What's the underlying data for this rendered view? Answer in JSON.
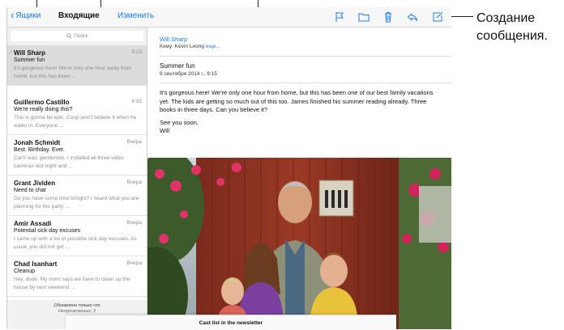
{
  "navbar": {
    "back_label": "Ящики",
    "title": "Входящие",
    "edit_label": "Изменить"
  },
  "toolbar_icons": [
    "flag-icon",
    "folder-icon",
    "trash-icon",
    "reply-icon",
    "compose-icon"
  ],
  "search": {
    "placeholder": "Поиск"
  },
  "mail_list": [
    {
      "sender": "Will Sharp",
      "time": "9:15",
      "subject": "Summer fun",
      "preview": "It's gorgeous here! We're only one hour away from home, but this has been ...",
      "selected": true
    },
    {
      "sender": "Guillermo Castillo",
      "time": "8:32",
      "subject": "We're really doing this?",
      "preview": "This is gonna be epic. Coop won't believe it when he walks in. Everyone ...",
      "selected": false
    },
    {
      "sender": "Jonah Schmidt",
      "time": "Вчера",
      "subject": "Best. Birthday. Ever.",
      "preview": "Can't wait, gentlemen. I installed all three video cameras last night and ...",
      "selected": false
    },
    {
      "sender": "Grant Jividen",
      "time": "Вчера",
      "subject": "Need to chat",
      "preview": "Do you have some time tonight? I heard what you are planning for the party ...",
      "selected": false
    },
    {
      "sender": "Amir Assadi",
      "time": "Вчера",
      "subject": "Potential sick day excuses",
      "preview": "I came up with a list of possible sick day excuses. As usual, you did not get ...",
      "selected": false
    },
    {
      "sender": "Chad Isanhart",
      "time": "Вчера",
      "subject": "Cleanup",
      "preview": "Hey, dude. My mom says we have to clean up the house by next weekend ...",
      "selected": false
    }
  ],
  "list_footer": {
    "updated": "Обновлено только что",
    "unread": "Непрочитанных: 2"
  },
  "message": {
    "from": "Will Sharp",
    "to_label": "Кому: Kevin Leong",
    "more_label": "еще...",
    "subject": "Summer fun",
    "date": "9 сентября 2014 г., 9:15",
    "body_p1": "It's gorgeous here! We're only one hour from home, but this has been one of our best family vacations yet. The kids are getting so much out of this too. James finished his summer reading already. Three books in three days. Can you believe it?",
    "body_p2": "See you soon,",
    "body_p3": "Will"
  },
  "bottom_card": {
    "title": "Cast list in the newsletter"
  },
  "callout": {
    "compose_label": "Создание сообщения."
  },
  "colors": {
    "accent": "#1a7cf0",
    "selected_row": "#dcdcdc"
  }
}
